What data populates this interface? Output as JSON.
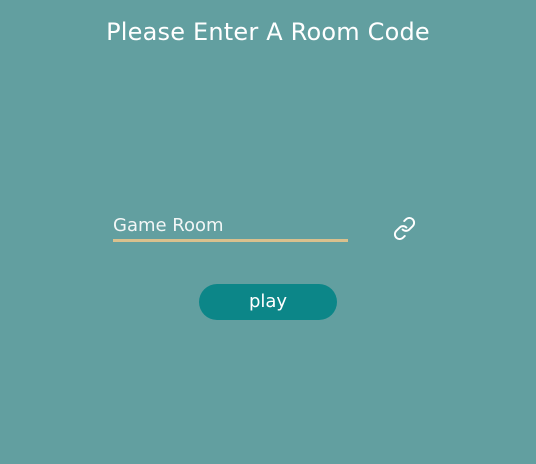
{
  "page": {
    "title": "Please Enter A Room Code"
  },
  "room_input": {
    "value": "",
    "placeholder": "Game Room"
  },
  "link_action": {
    "icon": "link-icon"
  },
  "play_button": {
    "label": "play"
  },
  "colors": {
    "background": "#629fa0",
    "input_underline": "#d9c08d",
    "button": "#0c8688",
    "text": "#ffffff"
  }
}
